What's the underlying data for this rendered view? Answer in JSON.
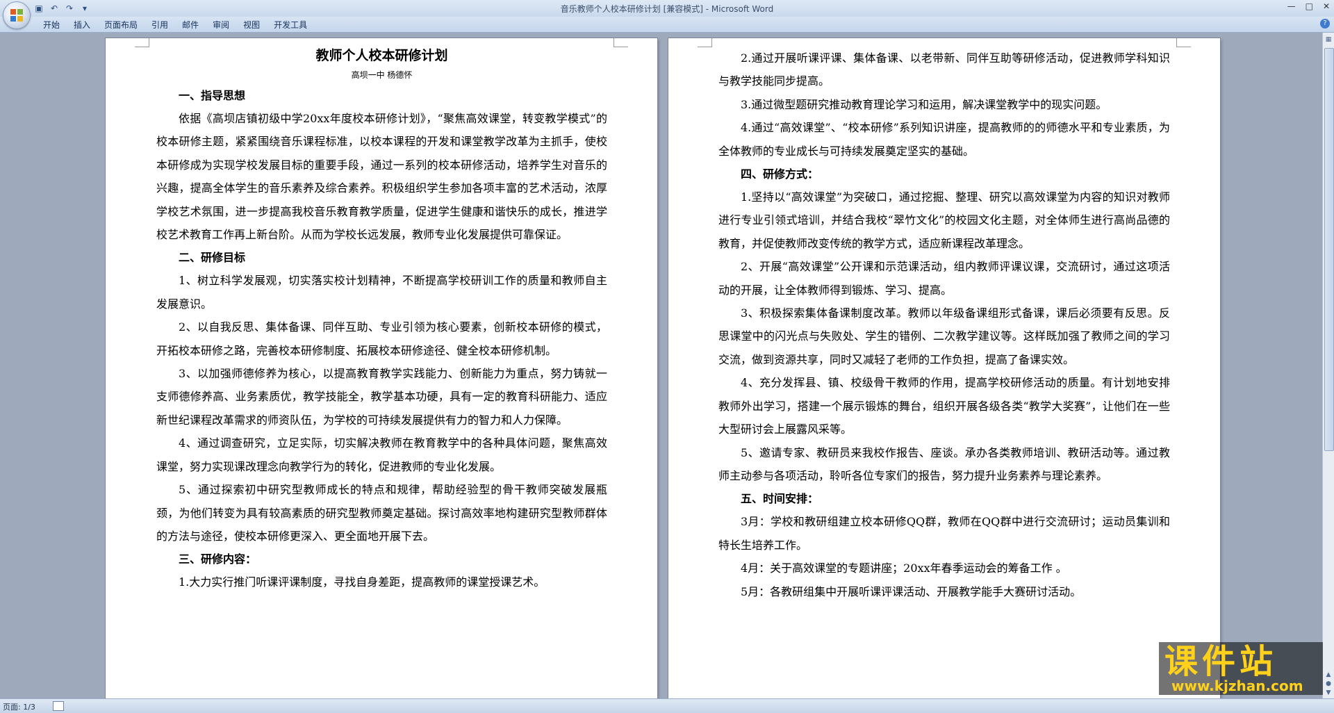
{
  "window": {
    "title": "音乐教师个人校本研修计划 [兼容模式] - Microsoft Word",
    "controls": [
      "—",
      "□",
      "✕"
    ]
  },
  "quick_access": [
    "save-icon",
    "undo-icon",
    "redo-icon",
    "customize-icon"
  ],
  "ribbon_tabs": [
    "开始",
    "插入",
    "页面布局",
    "引用",
    "邮件",
    "审阅",
    "视图",
    "开发工具"
  ],
  "document": {
    "title": "教师个人校本研修计划",
    "subtitle": "高坝一中     杨德怀",
    "page1": [
      {
        "type": "h",
        "text": "一、指导思想"
      },
      {
        "type": "p",
        "text": "依据《高坝店镇初级中学20xx年度校本研修计划》，“聚焦高效课堂，转变教学模式”的校本研修主题，紧紧围绕音乐课程标准，以校本课程的开发和课堂教学改革为主抓手，使校本研修成为实现学校发展目标的重要手段，通过一系列的校本研修活动，培养学生对音乐的兴趣，提高全体学生的音乐素养及综合素养。积极组织学生参加各项丰富的艺术活动，浓厚学校艺术氛围，进一步提高我校音乐教育教学质量，促进学生健康和谐快乐的成长，推进学校艺术教育工作再上新台阶。从而为学校长远发展，教师专业化发展提供可靠保证。"
      },
      {
        "type": "h",
        "text": "二、研修目标"
      },
      {
        "type": "p",
        "text": "1、树立科学发展观，切实落实校计划精神，不断提高学校研训工作的质量和教师自主发展意识。"
      },
      {
        "type": "p",
        "text": "2、以自我反思、集体备课、同伴互助、专业引领为核心要素，创新校本研修的模式，开拓校本研修之路，完善校本研修制度、拓展校本研修途径、健全校本研修机制。"
      },
      {
        "type": "p",
        "text": "3、以加强师德修养为核心，以提高教育教学实践能力、创新能力为重点，努力铸就一支师德修养高、业务素质优，教学技能全，教学基本功硬，具有一定的教育科研能力、适应新世纪课程改革需求的师资队伍，为学校的可持续发展提供有力的智力和人力保障。"
      },
      {
        "type": "p",
        "text": "4、通过调查研究，立足实际，切实解决教师在教育教学中的各种具体问题，聚焦高效课堂，努力实现课改理念向教学行为的转化，促进教师的专业化发展。"
      },
      {
        "type": "p",
        "text": "5、通过探索初中研究型教师成长的特点和规律，帮助经验型的骨干教师突破发展瓶颈，为他们转变为具有较高素质的研究型教师奠定基础。探讨高效率地构建研究型教师群体的方法与途径，使校本研修更深入、更全面地开展下去。"
      },
      {
        "type": "h",
        "text": "三、研修内容："
      },
      {
        "type": "p",
        "text": "1.大力实行推门听课评课制度，寻找自身差距，提高教师的课堂授课艺术。"
      }
    ],
    "page2": [
      {
        "type": "p",
        "text": "2.通过开展听课评课、集体备课、以老带新、同伴互助等研修活动，促进教师学科知识与教学技能同步提高。"
      },
      {
        "type": "p",
        "text": "3.通过微型题研究推动教育理论学习和运用，解决课堂教学中的现实问题。"
      },
      {
        "type": "p",
        "text": "4.通过“高效课堂”、“校本研修”系列知识讲座，提高教师的的师德水平和专业素质，为全体教师的专业成长与可持续发展奠定坚实的基础。"
      },
      {
        "type": "h",
        "text": "四、研修方式："
      },
      {
        "type": "p",
        "text": "1.坚持以“高效课堂”为突破口，通过挖掘、整理、研究以高效课堂为内容的知识对教师进行专业引领式培训，并结合我校“翠竹文化”的校园文化主题，对全体师生进行高尚品德的教育，并促使教师改变传统的教学方式，适应新课程改革理念。"
      },
      {
        "type": "p",
        "text": "2、开展“高效课堂”公开课和示范课活动，组内教师评课议课，交流研讨，通过这项活动的开展，让全体教师得到锻炼、学习、提高。"
      },
      {
        "type": "p",
        "text": "3、积极探索集体备课制度改革。教师以年级备课组形式备课，课后必须要有反思。反思课堂中的闪光点与失败处、学生的错例、二次教学建议等。这样既加强了教师之间的学习交流，做到资源共享，同时又减轻了老师的工作负担，提高了备课实效。"
      },
      {
        "type": "p",
        "text": "4、充分发挥县、镇、校级骨干教师的作用，提高学校研修活动的质量。有计划地安排教师外出学习，搭建一个展示锻炼的舞台，组织开展各级各类“教学大奖赛”，让他们在一些大型研讨会上展露风采等。"
      },
      {
        "type": "p",
        "text": "5、邀请专家、教研员来我校作报告、座谈。承办各类教师培训、教研活动等。通过教师主动参与各项活动，聆听各位专家们的报告，努力提升业务素养与理论素养。"
      },
      {
        "type": "h",
        "text": "五、时间安排："
      },
      {
        "type": "p",
        "text": "3月：学校和教研组建立校本研修QQ群，教师在QQ群中进行交流研讨；运动员集训和特长生培养工作。"
      },
      {
        "type": "p",
        "text": "4月：关于高效课堂的专题讲座；20xx年春季运动会的筹备工作 。"
      },
      {
        "type": "p",
        "text": "5月：各教研组集中开展听课评课活动、开展教学能手大赛研讨活动。"
      }
    ]
  },
  "statusbar": {
    "page_info": "页面: 1/3"
  },
  "watermark": {
    "name": "课件站",
    "url": "www.kjzhan.com"
  }
}
